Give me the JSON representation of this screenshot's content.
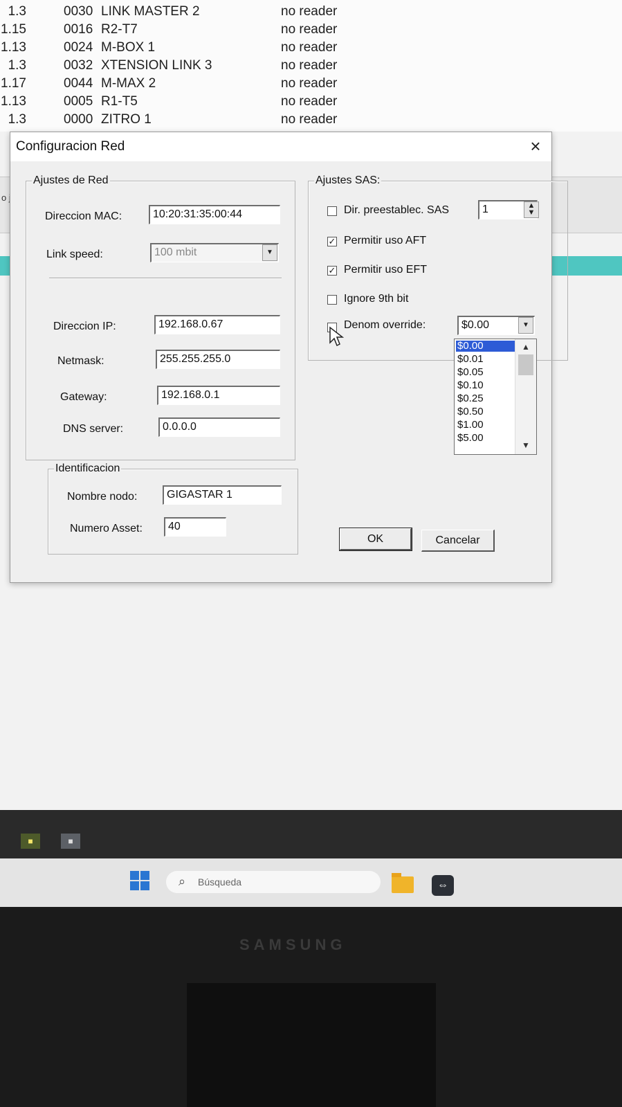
{
  "background_list": {
    "rows": [
      {
        "version": "1.3",
        "id": "0030",
        "name": "LINK MASTER 2",
        "status": "no reader"
      },
      {
        "version": "1.15",
        "id": "0016",
        "name": "R2-T7",
        "status": "no reader"
      },
      {
        "version": "1.13",
        "id": "0024",
        "name": "M-BOX 1",
        "status": "no reader"
      },
      {
        "version": "1.3",
        "id": "0032",
        "name": "XTENSION LINK 3",
        "status": "no reader"
      },
      {
        "version": "1.17",
        "id": "0044",
        "name": "M-MAX 2",
        "status": "no reader"
      },
      {
        "version": "1.13",
        "id": "0005",
        "name": "R1-T5",
        "status": "no reader"
      },
      {
        "version": "1.3",
        "id": "0000",
        "name": "ZITRO 1",
        "status": "no reader"
      }
    ],
    "side_fragment": "o j"
  },
  "dialog": {
    "title": "Configuracion Red",
    "close_glyph": "×",
    "network_group": {
      "legend": "Ajustes de Red",
      "mac_label": "Direccion MAC:",
      "mac_value": "10:20:31:35:00:44",
      "link_speed_label": "Link speed:",
      "link_speed_value": "100 mbit",
      "ip_label": "Direccion IP:",
      "ip_value": "192.168.0.67",
      "netmask_label": "Netmask:",
      "netmask_value": "255.255.255.0",
      "gateway_label": "Gateway:",
      "gateway_value": "192.168.0.1",
      "dns_label": "DNS server:",
      "dns_value": "0.0.0.0"
    },
    "ident_group": {
      "legend": "Identificacion",
      "node_name_label": "Nombre nodo:",
      "node_name_value": "GIGASTAR 1",
      "asset_label": "Numero Asset:",
      "asset_value": "40"
    },
    "sas_group": {
      "legend": "Ajustes SAS:",
      "preset_label": "Dir. preestablec. SAS",
      "preset_checked": false,
      "preset_value": "1",
      "aft_label": "Permitir uso AFT",
      "aft_checked": true,
      "eft_label": "Permitir uso EFT",
      "eft_checked": true,
      "ninth_bit_label": "Ignore 9th bit",
      "ninth_bit_checked": false,
      "denom_label": "Denom override:",
      "denom_checked": false,
      "denom_value": "$0.00",
      "denom_options": [
        "$0.00",
        "$0.01",
        "$0.05",
        "$0.10",
        "$0.25",
        "$0.50",
        "$1.00",
        "$5.00"
      ],
      "denom_selected_index": 0
    },
    "ok_label": "OK",
    "cancel_label": "Cancelar"
  },
  "taskbar": {
    "search_placeholder": "Búsqueda"
  },
  "monitor": {
    "brand": "SAMSUNG"
  },
  "colors": {
    "teal_strip": "#4fc6c1",
    "selection": "#2d5bd6",
    "start_blue": "#2a76d2",
    "folder_yellow": "#f0b42a"
  }
}
